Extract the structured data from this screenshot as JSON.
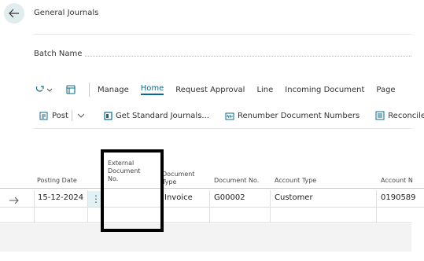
{
  "header": {
    "title": "General Journals"
  },
  "batch": {
    "label": "Batch Name"
  },
  "action_bar": {
    "items": [
      "Manage",
      "Home",
      "Request Approval",
      "Line",
      "Incoming Document",
      "Page"
    ],
    "active": "Home"
  },
  "commands": {
    "post": "Post",
    "get_standard": "Get Standard Journals...",
    "renumber": "Renumber Document Numbers",
    "reconcile": "Reconcile"
  },
  "columns": {
    "posting_date": "Posting Date",
    "external_doc_line1": "External",
    "external_doc_line2": "Document",
    "external_doc_line3": "No.",
    "doc_type_line1": "Document",
    "doc_type_line2": "Type",
    "document_no": "Document No.",
    "account_type": "Account Type",
    "account_no": "Account N"
  },
  "row": {
    "posting_date": "15-12-2024",
    "external_doc_no": "",
    "document_type": "Invoice",
    "document_no": "G00002",
    "account_type": "Customer",
    "account_no": "0190589"
  },
  "accent_color": "#0a6a8c"
}
